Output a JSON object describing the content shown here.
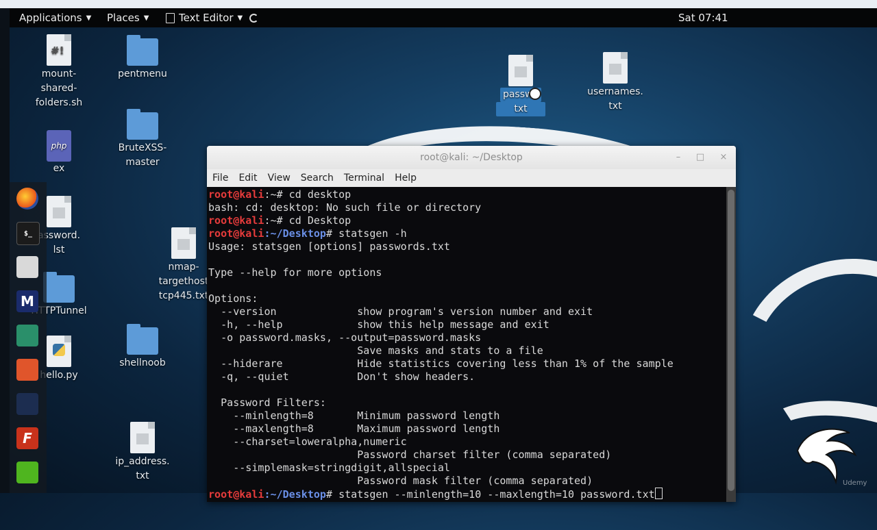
{
  "topbar": {
    "applications": "Applications",
    "places": "Places",
    "text_editor": "Text Editor",
    "clock": "Sat 07:41"
  },
  "desktop_icons": {
    "mount": [
      "mount-",
      "shared-",
      "folders.sh"
    ],
    "pentmenu": "pentmenu",
    "ex": "ex",
    "brutexss": [
      "BruteXSS-",
      "master"
    ],
    "password_lst": [
      "assword.",
      "lst"
    ],
    "nmap": [
      "nmap-",
      "targethost",
      "tcp445.txt"
    ],
    "httptunnel": "HTTPTunnel",
    "hello": "hello.py",
    "shellnoob": "shellnoob",
    "ip_address": [
      "ip_address.",
      "txt"
    ],
    "passwords_txt": [
      "passwo",
      "txt"
    ],
    "usernames": [
      "usernames.",
      "txt"
    ]
  },
  "terminal": {
    "title": "root@kali: ~/Desktop",
    "menu": [
      "File",
      "Edit",
      "View",
      "Search",
      "Terminal",
      "Help"
    ],
    "prompt_user": "root@kali",
    "lines": {
      "l1_cmd": ":~# cd desktop",
      "l2": "bash: cd: desktop: No such file or directory",
      "l3_cmd": ":~# cd Desktop",
      "l4_path": ":~/Desktop",
      "l4_cmd": "# statsgen -h",
      "l5": "Usage: statsgen [options] passwords.txt",
      "l6": "",
      "l7": "Type --help for more options",
      "l8": "",
      "l9": "Options:",
      "l10": "  --version             show program's version number and exit",
      "l11": "  -h, --help            show this help message and exit",
      "l12": "  -o password.masks, --output=password.masks",
      "l13": "                        Save masks and stats to a file",
      "l14": "  --hiderare            Hide statistics covering less than 1% of the sample",
      "l15": "  -q, --quiet           Don't show headers.",
      "l16": "",
      "l17": "  Password Filters:",
      "l18": "    --minlength=8       Minimum password length",
      "l19": "    --maxlength=8       Maximum password length",
      "l20": "    --charset=loweralpha,numeric",
      "l21": "                        Password charset filter (comma separated)",
      "l22": "    --simplemask=stringdigit,allspecial",
      "l23": "                        Password mask filter (comma separated)",
      "l24_path": ":~/Desktop",
      "l24_cmd": "# statsgen --minlength=10 --maxlength=10 password.txt"
    }
  },
  "watermark": "Udemy",
  "colors": {
    "prompt_user": "#e53b3b",
    "prompt_path": "#6a8fe6",
    "terminal_bg": "#0a0a0d",
    "selection": "#2f76b5"
  }
}
